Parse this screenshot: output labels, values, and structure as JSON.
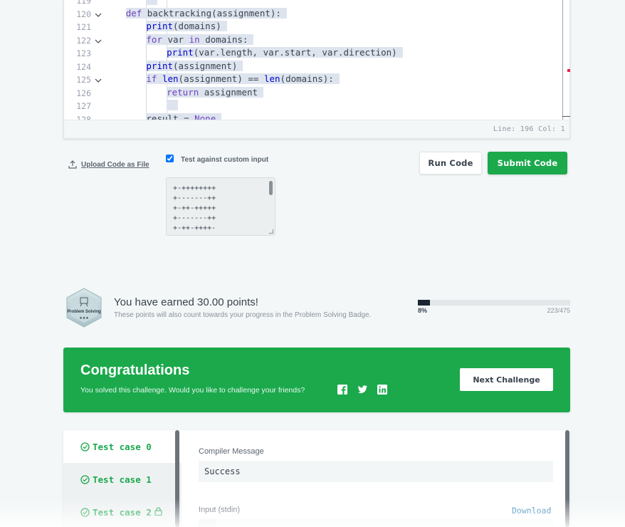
{
  "editor": {
    "lines": [
      {
        "num": "119",
        "fold": false,
        "indent": 0,
        "segments": []
      },
      {
        "num": "120",
        "fold": true,
        "indent": 1,
        "segments": [
          {
            "t": "def ",
            "c": "kw"
          },
          {
            "t": "backtracking(assignment):",
            "c": ""
          }
        ]
      },
      {
        "num": "121",
        "fold": false,
        "indent": 2,
        "segments": [
          {
            "t": "print",
            "c": "kw2"
          },
          {
            "t": "(domains)",
            "c": ""
          }
        ]
      },
      {
        "num": "122",
        "fold": true,
        "indent": 2,
        "segments": [
          {
            "t": "for ",
            "c": "kw"
          },
          {
            "t": "var ",
            "c": ""
          },
          {
            "t": "in ",
            "c": "kw"
          },
          {
            "t": "domains:",
            "c": ""
          }
        ]
      },
      {
        "num": "123",
        "fold": false,
        "indent": 3,
        "segments": [
          {
            "t": "print",
            "c": "kw2"
          },
          {
            "t": "(var.length, var.start, var.direction)",
            "c": ""
          }
        ]
      },
      {
        "num": "124",
        "fold": false,
        "indent": 2,
        "segments": [
          {
            "t": "print",
            "c": "kw2"
          },
          {
            "t": "(assignment)",
            "c": ""
          }
        ]
      },
      {
        "num": "125",
        "fold": true,
        "indent": 2,
        "segments": [
          {
            "t": "if ",
            "c": "kw"
          },
          {
            "t": "len",
            "c": "kw2"
          },
          {
            "t": "(assignment) == ",
            "c": ""
          },
          {
            "t": "len",
            "c": "kw2"
          },
          {
            "t": "(domains):",
            "c": ""
          }
        ]
      },
      {
        "num": "126",
        "fold": false,
        "indent": 3,
        "segments": [
          {
            "t": "return ",
            "c": "kw"
          },
          {
            "t": "assignment",
            "c": ""
          }
        ]
      },
      {
        "num": "127",
        "fold": false,
        "indent": 0,
        "segments": []
      },
      {
        "num": "128",
        "fold": false,
        "indent": 2,
        "segments": [
          {
            "t": "result = ",
            "c": ""
          },
          {
            "t": "None",
            "c": "kw"
          }
        ]
      }
    ],
    "status": "Line: 196 Col: 1"
  },
  "upload_label": "Upload Code as File",
  "custom_input": {
    "checked": true,
    "label": "Test against custom input",
    "lines": [
      "+-++++++++",
      "+-------++",
      "+-++-+++++",
      "+-------++",
      "+-++-++++-",
      "+-++-++++-"
    ]
  },
  "buttons": {
    "run": "Run Code",
    "submit": "Submit Code"
  },
  "points": {
    "badge_label": "Problem Solving",
    "badge_stars": "★★★",
    "title": "You have earned 30.00 points!",
    "subtitle": "These points will also count towards your progress in the Problem Solving Badge.",
    "progress_fraction": 0.08,
    "progress_pct": "8%",
    "progress_count": "223/475"
  },
  "congrats": {
    "title": "Congratulations",
    "subtitle": "You solved this challenge. Would you like to challenge your friends?",
    "next_label": "Next Challenge"
  },
  "tests": {
    "cases": [
      {
        "label": "Test case 0",
        "active": true,
        "locked": false
      },
      {
        "label": "Test case 1",
        "active": false,
        "locked": false
      },
      {
        "label": "Test case 2",
        "active": false,
        "locked": true
      }
    ],
    "compiler_label": "Compiler Message",
    "compiler_value": "Success",
    "input_label": "Input (stdin)",
    "download_label": "Download"
  },
  "colors": {
    "accent": "#1ba94c",
    "dark": "#39424e"
  }
}
